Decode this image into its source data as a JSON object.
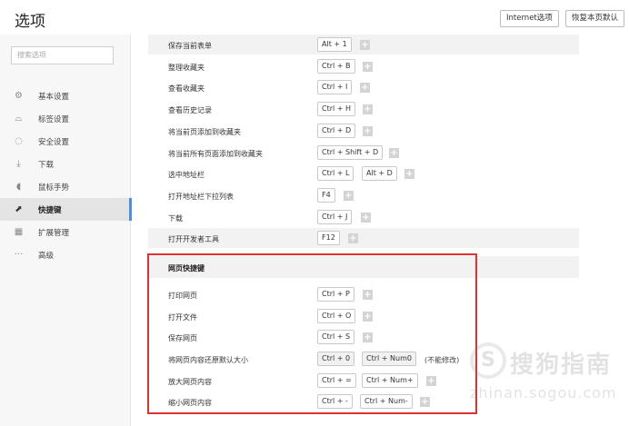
{
  "header": {
    "title": "选项",
    "internet_options_label": "Internet选项",
    "restore_defaults_label": "恢复本页默认"
  },
  "sidebar": {
    "search_placeholder": "搜索选项",
    "items": [
      {
        "label": "基本设置",
        "icon": "gear-icon",
        "active": false
      },
      {
        "label": "标签设置",
        "icon": "tab-icon",
        "active": false
      },
      {
        "label": "安全设置",
        "icon": "shield-check-icon",
        "active": false
      },
      {
        "label": "下载",
        "icon": "download-icon",
        "active": false
      },
      {
        "label": "鼠标手势",
        "icon": "mouse-icon",
        "active": false
      },
      {
        "label": "快捷键",
        "icon": "shortcut-arrow-icon",
        "active": true
      },
      {
        "label": "扩展管理",
        "icon": "extensions-grid-icon",
        "active": false
      },
      {
        "label": "高级",
        "icon": "more-dots-icon",
        "active": false
      }
    ],
    "accent_color": "#4d8fdc"
  },
  "shortcuts": [
    {
      "name": "保存当前表单",
      "keys": [
        "Alt + 1"
      ]
    },
    {
      "name": "整理收藏夹",
      "keys": [
        "Ctrl + B"
      ]
    },
    {
      "name": "查看收藏夹",
      "keys": [
        "Ctrl + I"
      ]
    },
    {
      "name": "查看历史记录",
      "keys": [
        "Ctrl + H"
      ]
    },
    {
      "name": "将当前页添加到收藏夹",
      "keys": [
        "Ctrl + D"
      ]
    },
    {
      "name": "将当前所有页面添加到收藏夹",
      "keys": [
        "Ctrl + Shift + D"
      ]
    },
    {
      "name": "选中地址栏",
      "keys": [
        "Ctrl + L",
        "Alt + D"
      ]
    },
    {
      "name": "打开地址栏下拉列表",
      "keys": [
        "F4"
      ]
    },
    {
      "name": "下载",
      "keys": [
        "Ctrl + J"
      ]
    },
    {
      "name": "打开开发者工具",
      "keys": [
        "F12"
      ]
    }
  ],
  "web_section": {
    "title": "网页快捷键",
    "items": [
      {
        "name": "打印网页",
        "keys": [
          "Ctrl + P"
        ]
      },
      {
        "name": "打开文件",
        "keys": [
          "Ctrl + O"
        ]
      },
      {
        "name": "保存网页",
        "keys": [
          "Ctrl + S"
        ]
      },
      {
        "name": "将网页内容还原默认大小",
        "keys": [
          "Ctrl + 0",
          "Ctrl + Num0"
        ],
        "note": "(不能修改)"
      },
      {
        "name": "放大网页内容",
        "keys": [
          "Ctrl + =",
          "Ctrl + Num+"
        ]
      },
      {
        "name": "缩小网页内容",
        "keys": [
          "Ctrl + -",
          "Ctrl + Num-"
        ]
      }
    ],
    "highlight_color": "#e03030"
  },
  "watermark": {
    "text": "搜狗指南",
    "url": "zhinan.sogou.com"
  }
}
